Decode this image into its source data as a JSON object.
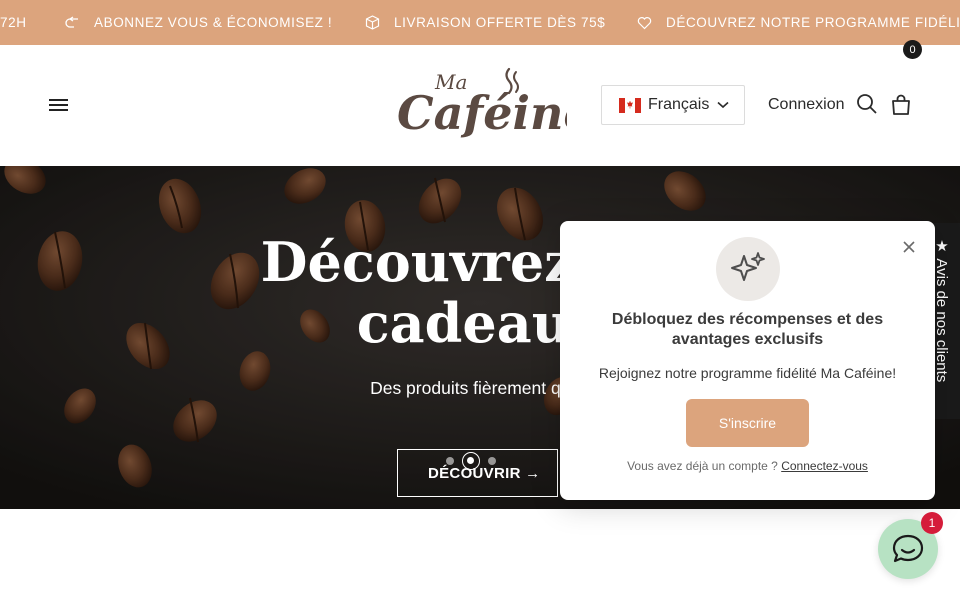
{
  "announcement": {
    "partial_left": "72H",
    "items": [
      {
        "icon": "return-arrow-icon",
        "text": "ABONNEZ VOUS & ÉCONOMISEZ !"
      },
      {
        "icon": "box-icon",
        "text": "LIVRAISON OFFERTE DÈS 75$"
      },
      {
        "icon": "heart-icon",
        "text": "DÉCOUVREZ NOTRE PROGRAMME FIDÉLITÉ"
      }
    ]
  },
  "header": {
    "logo": {
      "small": "Ma",
      "main": "Caféine"
    },
    "language": {
      "label": "Français",
      "flag": "canada-flag-icon"
    },
    "login_label": "Connexion",
    "cart_count": "0"
  },
  "hero": {
    "title_line1": "Découvrez nos",
    "title_line2": "cadeaux",
    "subtitle": "Des produits fièrement québ",
    "button_label": "DÉCOUVRIR →",
    "slides": 3,
    "active_slide": 2
  },
  "reviews_tab": "★ Avis de nos clients",
  "popup": {
    "title": "Débloquez des récompenses et des avantages exclusifs",
    "text": "Rejoignez notre programme fidélité Ma Caféine!",
    "button_label": "S'inscrire",
    "footer_text": "Vous avez déjà un compte ?",
    "footer_link": "Connectez-vous"
  },
  "chat": {
    "badge": "1"
  },
  "colors": {
    "accent": "#dca47d",
    "dark": "#1a1a1a",
    "chat": "#b7e2c3",
    "badge_red": "#d51c3a"
  }
}
